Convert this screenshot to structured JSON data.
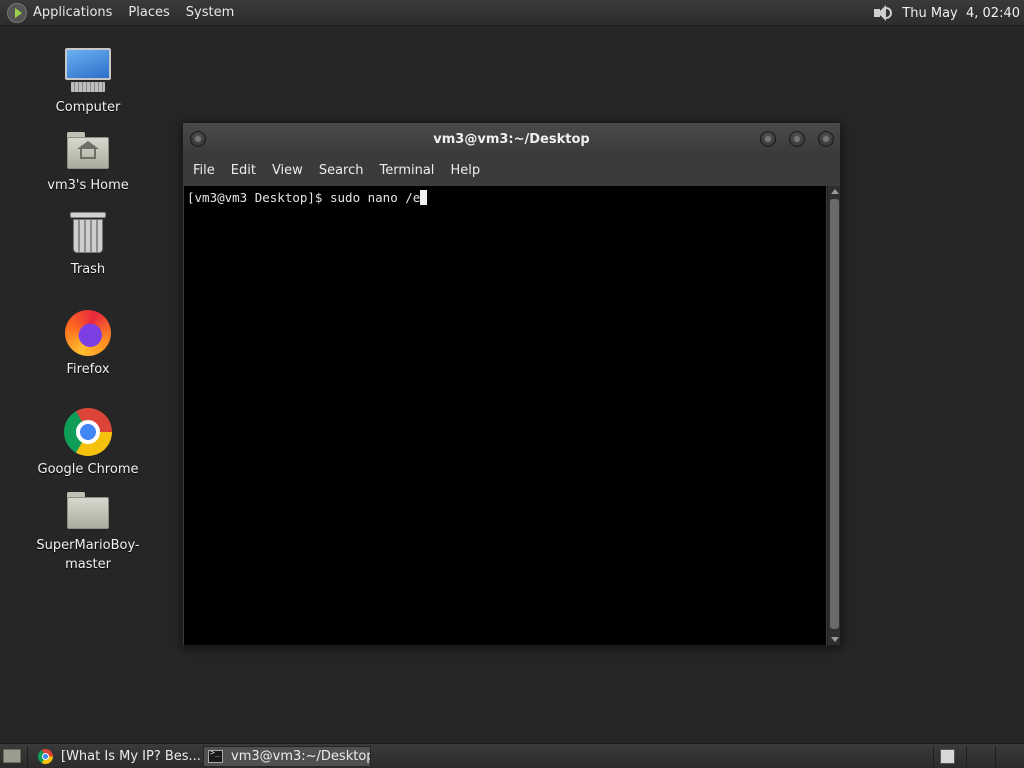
{
  "top_panel": {
    "menus": [
      "Applications",
      "Places",
      "System"
    ],
    "clock": "Thu May  4, 02:40"
  },
  "desktop": {
    "icons": [
      {
        "label": "Computer",
        "icon": "computer-icon"
      },
      {
        "label": "vm3's Home",
        "icon": "home-folder-icon"
      },
      {
        "label": "Trash",
        "icon": "trash-icon"
      },
      {
        "label": "Firefox",
        "icon": "firefox-icon"
      },
      {
        "label": "Google Chrome",
        "icon": "chrome-icon"
      },
      {
        "label": "SuperMarioBoy-master",
        "icon": "folder-icon"
      }
    ]
  },
  "terminal": {
    "title": "vm3@vm3:~/Desktop",
    "menu": [
      "File",
      "Edit",
      "View",
      "Search",
      "Terminal",
      "Help"
    ],
    "prompt": "[vm3@vm3 Desktop]$ ",
    "command": "sudo nano /e"
  },
  "taskbar": {
    "tasks": [
      {
        "label": "[What Is My IP? Bes...",
        "icon": "chrome-icon",
        "active": false
      },
      {
        "label": "vm3@vm3:~/Desktop",
        "icon": "terminal-icon",
        "active": true
      }
    ]
  },
  "colors": {
    "desktop_bg": "#262626",
    "terminal_bg": "#000000",
    "panel_bg": "#333333"
  }
}
